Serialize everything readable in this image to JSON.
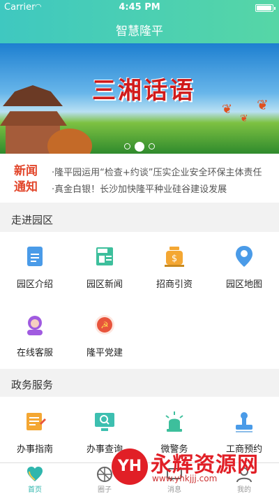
{
  "status": {
    "carrier": "Carrier",
    "time": "4:45 PM",
    "battery_level": 0.95
  },
  "header": {
    "title": "智慧隆平"
  },
  "banner": {
    "title": "三湘话语",
    "slide_count": 3,
    "active_index": 1
  },
  "news": {
    "badge": [
      "新闻",
      "通知"
    ],
    "items": [
      "·隆平园运用“检查+约谈”压实企业安全环保主体责任",
      "·真金白银！长沙加快隆平种业硅谷建设发展"
    ]
  },
  "park": {
    "title": "走进园区",
    "items": [
      {
        "label": "园区介绍",
        "icon": "document-icon",
        "color": "#4a9be8"
      },
      {
        "label": "园区新闻",
        "icon": "news-icon",
        "color": "#3dbf9c"
      },
      {
        "label": "招商引资",
        "icon": "money-bag-icon",
        "color": "#f4a733"
      },
      {
        "label": "园区地图",
        "icon": "map-pin-icon",
        "color": "#4a9be8"
      },
      {
        "label": "在线客服",
        "icon": "headset-icon",
        "color": "#a05be0"
      },
      {
        "label": "隆平党建",
        "icon": "party-emblem-icon",
        "color": "#e8543c"
      }
    ]
  },
  "gov": {
    "title": "政务服务",
    "items": [
      {
        "label": "办事指南",
        "icon": "guide-icon",
        "color": "#f4a733"
      },
      {
        "label": "办事查询",
        "icon": "search-monitor-icon",
        "color": "#3dbfb0"
      },
      {
        "label": "微警务",
        "icon": "police-light-icon",
        "color": "#3dbf9c"
      },
      {
        "label": "工商预约",
        "icon": "stamp-icon",
        "color": "#4a9be8"
      }
    ]
  },
  "tabbar": {
    "items": [
      {
        "label": "首页",
        "icon": "heart-home-icon",
        "active": true
      },
      {
        "label": "圈子",
        "icon": "circle-icon",
        "active": false
      },
      {
        "label": "消息",
        "icon": "message-icon",
        "active": false
      },
      {
        "label": "我的",
        "icon": "person-icon",
        "active": false
      }
    ]
  },
  "watermark": {
    "logo": "YH",
    "name": "永辉资源网",
    "url": "www.yhkjjj.com"
  },
  "colors": {
    "accent": "#2fb6ad",
    "news_badge": "#e2472c",
    "watermark": "#e11f26"
  }
}
